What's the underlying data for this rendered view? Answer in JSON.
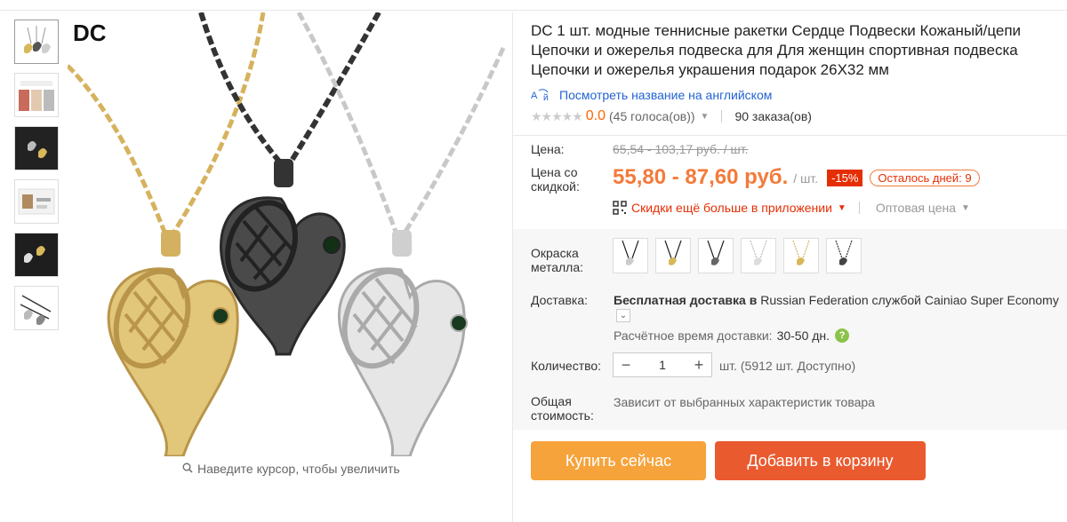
{
  "gallery": {
    "brand_mark": "DC",
    "zoom_hint": "Наведите курсор, чтобы увеличить",
    "thumbnails": [
      "thumb-1",
      "thumb-2",
      "thumb-3",
      "thumb-4",
      "thumb-5",
      "thumb-6"
    ]
  },
  "product": {
    "title": "DC 1 шт. модные теннисные ракетки Сердце Подвески Кожаный/цепи Цепочки и ожерелья подвеска для Для женщин спортивная подвеска Цепочки и ожерелья украшения подарок 26X32 мм",
    "translate_link": "Посмотреть название на английском",
    "rating": {
      "stars": "★★★★★",
      "score": "0.0",
      "votes": "(45 голоса(ов))",
      "orders": "90 заказа(ов)"
    }
  },
  "price": {
    "label": "Цена:",
    "old": "65,54 - 103,17 руб. / шт.",
    "discount_label": "Цена со скидкой:",
    "current": "55,80 - 87,60 руб.",
    "unit": "/ шт.",
    "discount_pct": "-15%",
    "days_left": "Осталось дней: 9",
    "app_discount": "Скидки ещё больше в приложении",
    "wholesale": "Оптовая цена"
  },
  "options": {
    "color_label": "Окраска металла:",
    "swatches": [
      "silver-black-cord",
      "gold-black-cord",
      "gunmetal-black-cord",
      "silver-chain",
      "gold-chain",
      "black-chain"
    ],
    "delivery_label": "Доставка:",
    "delivery_bold": "Бесплатная доставка в",
    "delivery_rest": " Russian Federation службой Cainiao Super Economy",
    "eta_label": "Расчётное время доставки:",
    "eta_value": "30-50 дн.",
    "help_icon": "?",
    "qty_label": "Количество:",
    "qty_minus": "−",
    "qty_value": "1",
    "qty_plus": "+",
    "qty_note": "шт. (5912 шт. Доступно)",
    "total_label": "Общая стоимость:",
    "total_note": "Зависит от выбранных характеристик товара"
  },
  "actions": {
    "buy_now": "Купить сейчас",
    "add_to_cart": "Добавить в корзину"
  },
  "colors": {
    "accent": "#f47a3a",
    "buy": "#f6a33b",
    "cart": "#ea5a2f",
    "link": "#2263d3"
  }
}
